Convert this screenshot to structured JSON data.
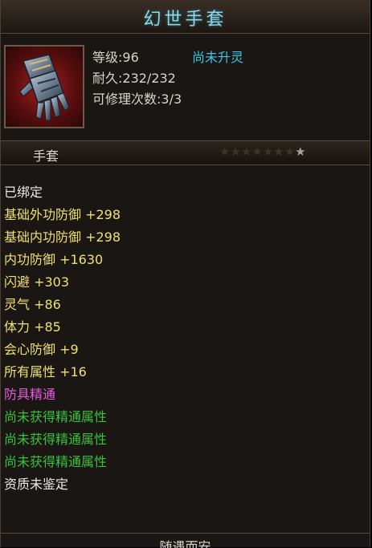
{
  "title": "幻世手套",
  "item": {
    "icon": "gauntlet-icon",
    "level": "等级:96",
    "spirit_status": "尚未升灵",
    "durability": "耐久:232/232",
    "repairs": "可修理次数:3/3"
  },
  "type_bar": {
    "label": "手套",
    "stars_total": 8,
    "stars_lit": 1
  },
  "attributes": [
    {
      "text": "已绑定",
      "color": "white"
    },
    {
      "text": "基础外功防御 +298",
      "color": "yellow"
    },
    {
      "text": "基础内功防御 +298",
      "color": "yellow"
    },
    {
      "text": "内功防御 +1630",
      "color": "yellow"
    },
    {
      "text": "闪避 +303",
      "color": "yellow"
    },
    {
      "text": "灵气 +86",
      "color": "yellow"
    },
    {
      "text": "体力 +85",
      "color": "yellow"
    },
    {
      "text": "会心防御 +9",
      "color": "yellow"
    },
    {
      "text": "所有属性 +16",
      "color": "yellow"
    },
    {
      "text": "防具精通",
      "color": "pink"
    },
    {
      "text": "尚未获得精通属性",
      "color": "green"
    },
    {
      "text": "尚未获得精通属性",
      "color": "green"
    },
    {
      "text": "尚未获得精通属性",
      "color": "green"
    },
    {
      "text": "资质未鉴定",
      "color": "white"
    }
  ],
  "footer": "随遇而安",
  "colors": {
    "title": "#8fd8e8",
    "cyan": "#38c8e4",
    "yellow": "#f0e070",
    "pink": "#e85ae0",
    "green": "#39c23c",
    "panel": "#1a1613"
  }
}
